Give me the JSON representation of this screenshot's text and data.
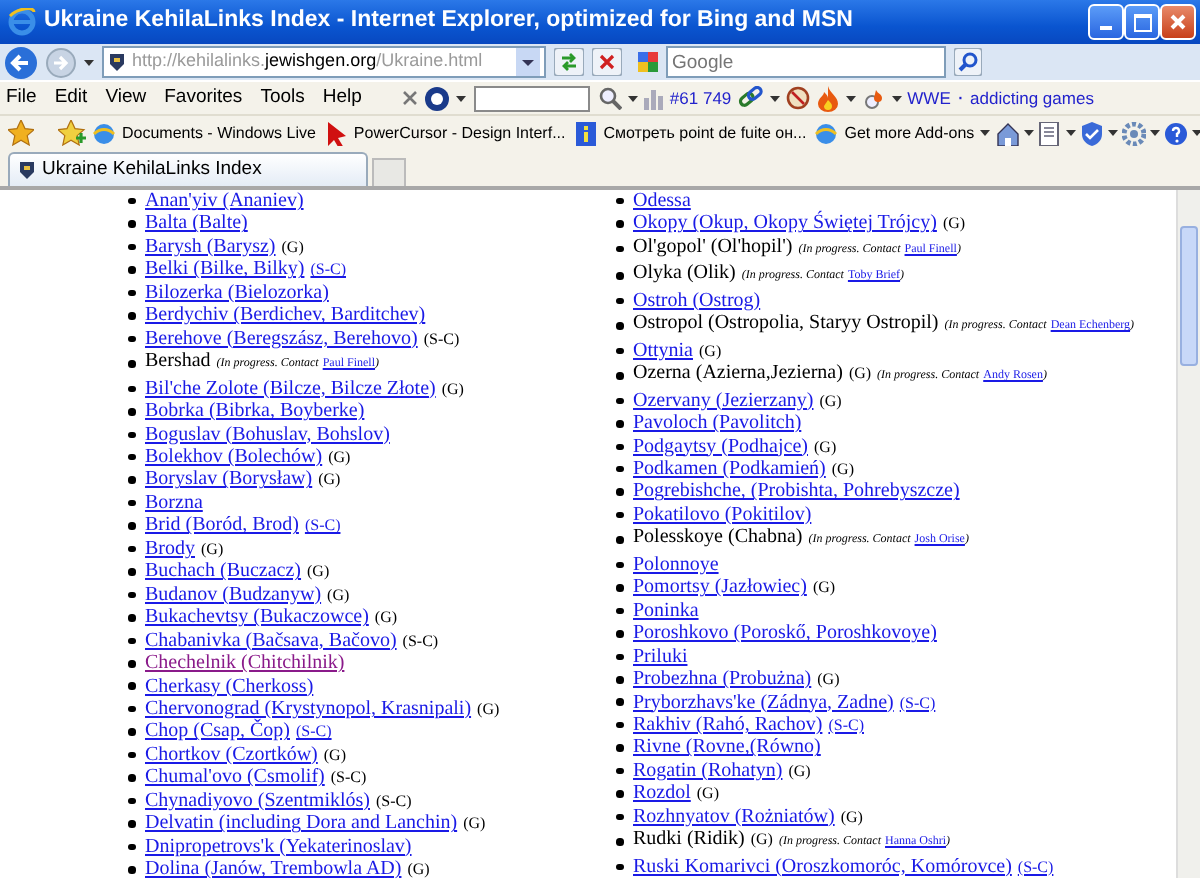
{
  "window": {
    "title": "Ukraine KehilaLinks Index - Internet Explorer, optimized for Bing and MSN"
  },
  "address_bar": {
    "url_prefix": "http://kehilalinks.",
    "url_domain": "jewishgen.org",
    "url_suffix": "/Ukraine.html"
  },
  "search": {
    "placeholder": "Google"
  },
  "menu": [
    "File",
    "Edit",
    "View",
    "Favorites",
    "Tools",
    "Help"
  ],
  "toolbar": {
    "counter": "#61 749",
    "links": [
      "WWE",
      "addicting games"
    ],
    "separator": "·"
  },
  "favorites": [
    {
      "label": "Documents - Windows Live",
      "dropdown": false
    },
    {
      "label": "PowerCursor - Design Interf...",
      "dropdown": false
    },
    {
      "label": "Смотреть point de fuite он...",
      "dropdown": false
    },
    {
      "label": "Get more Add-ons",
      "dropdown": true
    }
  ],
  "tabs": [
    {
      "label": "Ukraine KehilaLinks Index",
      "selected": true
    }
  ],
  "columns": [
    [
      {
        "kind": "link",
        "name": "Anan'yiv (Ananiev)"
      },
      {
        "kind": "link",
        "name": "Balta (Balte)"
      },
      {
        "kind": "link",
        "name": "Barysh (Barysz)",
        "parts": [
          {
            "kind": "tag",
            "text": "(G)"
          }
        ]
      },
      {
        "kind": "link",
        "name": "Belki (Bilke, Bilky)",
        "parts": [
          {
            "kind": "link",
            "text": "(S-C)"
          }
        ]
      },
      {
        "kind": "link",
        "name": "Bilozerka (Bielozorka)"
      },
      {
        "kind": "link",
        "name": "Berdychiv (Berdichev, Barditchev)"
      },
      {
        "kind": "link",
        "name": "Berehove (Beregszász, Berehovo)",
        "parts": [
          {
            "kind": "tag",
            "text": "(S-C)"
          }
        ]
      },
      {
        "kind": "text",
        "name": "Bershad",
        "note": {
          "lead": "(In progress. Contact",
          "contact": "Paul Finell",
          "tail": ")"
        }
      },
      {
        "kind": "link",
        "name": "Bil'che Zolote (Bilcze, Bilcze Złote)",
        "parts": [
          {
            "kind": "tag",
            "text": "(G)"
          }
        ]
      },
      {
        "kind": "link",
        "name": "Bobrka (Bibrka, Boyberke)"
      },
      {
        "kind": "link",
        "name": "Boguslav (Bohuslav, Bohslov)"
      },
      {
        "kind": "link",
        "name": "Bolekhov (Bolechów)",
        "parts": [
          {
            "kind": "tag",
            "text": "(G)"
          }
        ]
      },
      {
        "kind": "link",
        "name": "Boryslav (Borysław)",
        "parts": [
          {
            "kind": "tag",
            "text": "(G)"
          }
        ]
      },
      {
        "kind": "link",
        "name": "Borzna"
      },
      {
        "kind": "link",
        "name": "Brid (Boród, Brod)",
        "parts": [
          {
            "kind": "link",
            "text": "(S-C)"
          }
        ]
      },
      {
        "kind": "link",
        "name": "Brody",
        "parts": [
          {
            "kind": "tag",
            "text": "(G)"
          }
        ]
      },
      {
        "kind": "link",
        "name": "Buchach (Buczacz)",
        "parts": [
          {
            "kind": "tag",
            "text": "(G)"
          }
        ]
      },
      {
        "kind": "link",
        "name": "Budanov (Budzanyw)",
        "parts": [
          {
            "kind": "tag",
            "text": "(G)"
          }
        ]
      },
      {
        "kind": "link",
        "name": "Bukachevtsy (Bukaczowce)",
        "parts": [
          {
            "kind": "tag",
            "text": "(G)"
          }
        ]
      },
      {
        "kind": "link",
        "name": "Chabanivka (Bačsava, Bačovo)",
        "parts": [
          {
            "kind": "tag",
            "text": "(S-C)"
          }
        ]
      },
      {
        "kind": "visited",
        "name": "Chechelnik (Chitchilnik)"
      },
      {
        "kind": "link",
        "name": "Cherkasy (Cherkoss)"
      },
      {
        "kind": "link",
        "name": "Chervonograd (Krystynopol, Krasnipali)",
        "parts": [
          {
            "kind": "tag",
            "text": "(G)"
          }
        ]
      },
      {
        "kind": "link",
        "name": "Chop (Csap, Čop)",
        "parts": [
          {
            "kind": "link",
            "text": "(S-C)"
          }
        ]
      },
      {
        "kind": "link",
        "name": "Chortkov (Czortków)",
        "parts": [
          {
            "kind": "tag",
            "text": "(G)"
          }
        ]
      },
      {
        "kind": "link",
        "name": "Chumal'ovo (Csmolif)",
        "parts": [
          {
            "kind": "tag",
            "text": "(S-C)"
          }
        ]
      },
      {
        "kind": "link",
        "name": "Chynadiyovo (Szentmiklós)",
        "parts": [
          {
            "kind": "tag",
            "text": "(S-C)"
          }
        ]
      },
      {
        "kind": "link",
        "name": "Delvatin (including Dora and Lanchin)",
        "parts": [
          {
            "kind": "tag",
            "text": "(G)"
          }
        ]
      },
      {
        "kind": "link",
        "name": "Dnipropetrovs'k (Yekaterinoslav)"
      },
      {
        "kind": "link",
        "name": "Dolina (Janów, Trembowla AD)",
        "parts": [
          {
            "kind": "tag",
            "text": "(G)"
          }
        ]
      }
    ],
    [
      {
        "kind": "link",
        "name": "Odessa"
      },
      {
        "kind": "link",
        "name": "Okopy (Okup, Okopy Świętej Trójcy)",
        "parts": [
          {
            "kind": "tag",
            "text": "(G)"
          }
        ]
      },
      {
        "kind": "text",
        "name": "Ol'gopol' (Ol'hopil')",
        "note": {
          "lead": "(In progress. Contact",
          "contact": "Paul Finell",
          "tail": ")"
        }
      },
      {
        "kind": "text",
        "name": "Olyka (Olik)",
        "note": {
          "lead": "(In progress. Contact",
          "contact": "Toby Brief",
          "tail": ")"
        }
      },
      {
        "kind": "link",
        "name": "Ostroh (Ostrog)"
      },
      {
        "kind": "text",
        "name": "Ostropol (Ostropolia, Staryy Ostropil)",
        "note": {
          "lead": "(In progress. Contact",
          "contact": "Dean Echenberg",
          "tail": ")"
        }
      },
      {
        "kind": "link",
        "name": "Ottynia",
        "parts": [
          {
            "kind": "tag",
            "text": "(G)"
          }
        ]
      },
      {
        "kind": "text",
        "name": "Ozerna (Azierna,Jezierna)",
        "parts": [
          {
            "kind": "tag",
            "text": "(G)"
          }
        ],
        "note": {
          "lead": "(In progress. Contact",
          "contact": "Andy Rosen",
          "tail": ")"
        }
      },
      {
        "kind": "link",
        "name": "Ozervany (Jezierzany)",
        "parts": [
          {
            "kind": "tag",
            "text": "(G)"
          }
        ]
      },
      {
        "kind": "link",
        "name": "Pavoloch (Pavolitch)"
      },
      {
        "kind": "link",
        "name": "Podgaytsy (Podhajce)",
        "parts": [
          {
            "kind": "tag",
            "text": "(G)"
          }
        ]
      },
      {
        "kind": "link",
        "name": "Podkamen (Podkamień)",
        "parts": [
          {
            "kind": "tag",
            "text": "(G)"
          }
        ]
      },
      {
        "kind": "link",
        "name": "Pogrebishche, (Probishta, Pohrebyszcze)"
      },
      {
        "kind": "link",
        "name": "Pokatilovo (Pokitilov)"
      },
      {
        "kind": "text",
        "name": "Polesskoye (Chabna)",
        "note": {
          "lead": "(In progress. Contact",
          "contact": "Josh Orise",
          "tail": ")"
        }
      },
      {
        "kind": "link",
        "name": "Polonnoye"
      },
      {
        "kind": "link",
        "name": "Pomortsy (Jazłowiec)",
        "parts": [
          {
            "kind": "tag",
            "text": "(G)"
          }
        ]
      },
      {
        "kind": "link",
        "name": "Poninka"
      },
      {
        "kind": "link",
        "name": "Poroshkovo (Poroskő, Poroshkovoye)"
      },
      {
        "kind": "link",
        "name": "Priluki"
      },
      {
        "kind": "link",
        "name": "Probezhna (Probużna)",
        "parts": [
          {
            "kind": "tag",
            "text": "(G)"
          }
        ]
      },
      {
        "kind": "link",
        "name": "Pryborzhavs'ke (Zádnya, Zadne)",
        "parts": [
          {
            "kind": "link",
            "text": "(S-C)"
          }
        ]
      },
      {
        "kind": "link",
        "name": "Rakhiv (Rahó, Rachov)",
        "parts": [
          {
            "kind": "link",
            "text": "(S-C)"
          }
        ]
      },
      {
        "kind": "link",
        "name": "Rivne (Rovne,(Równo)"
      },
      {
        "kind": "link",
        "name": "Rogatin (Rohatyn)",
        "parts": [
          {
            "kind": "tag",
            "text": "(G)"
          }
        ]
      },
      {
        "kind": "link",
        "name": "Rozdol",
        "parts": [
          {
            "kind": "tag",
            "text": "(G)"
          }
        ]
      },
      {
        "kind": "link",
        "name": "Rozhnyatov (Rożniatów)",
        "parts": [
          {
            "kind": "tag",
            "text": "(G)"
          }
        ]
      },
      {
        "kind": "text",
        "name": "Rudki (Ridik)",
        "parts": [
          {
            "kind": "tag",
            "text": "(G)"
          }
        ],
        "note": {
          "lead": "(In progress. Contact",
          "contact": "Hanna Oshri",
          "tail": ")"
        }
      },
      {
        "kind": "link",
        "name": "Ruski Komarivci (Oroszkomoróc, Komórovce)",
        "parts": [
          {
            "kind": "link",
            "text": "(S-C)"
          }
        ]
      }
    ]
  ]
}
